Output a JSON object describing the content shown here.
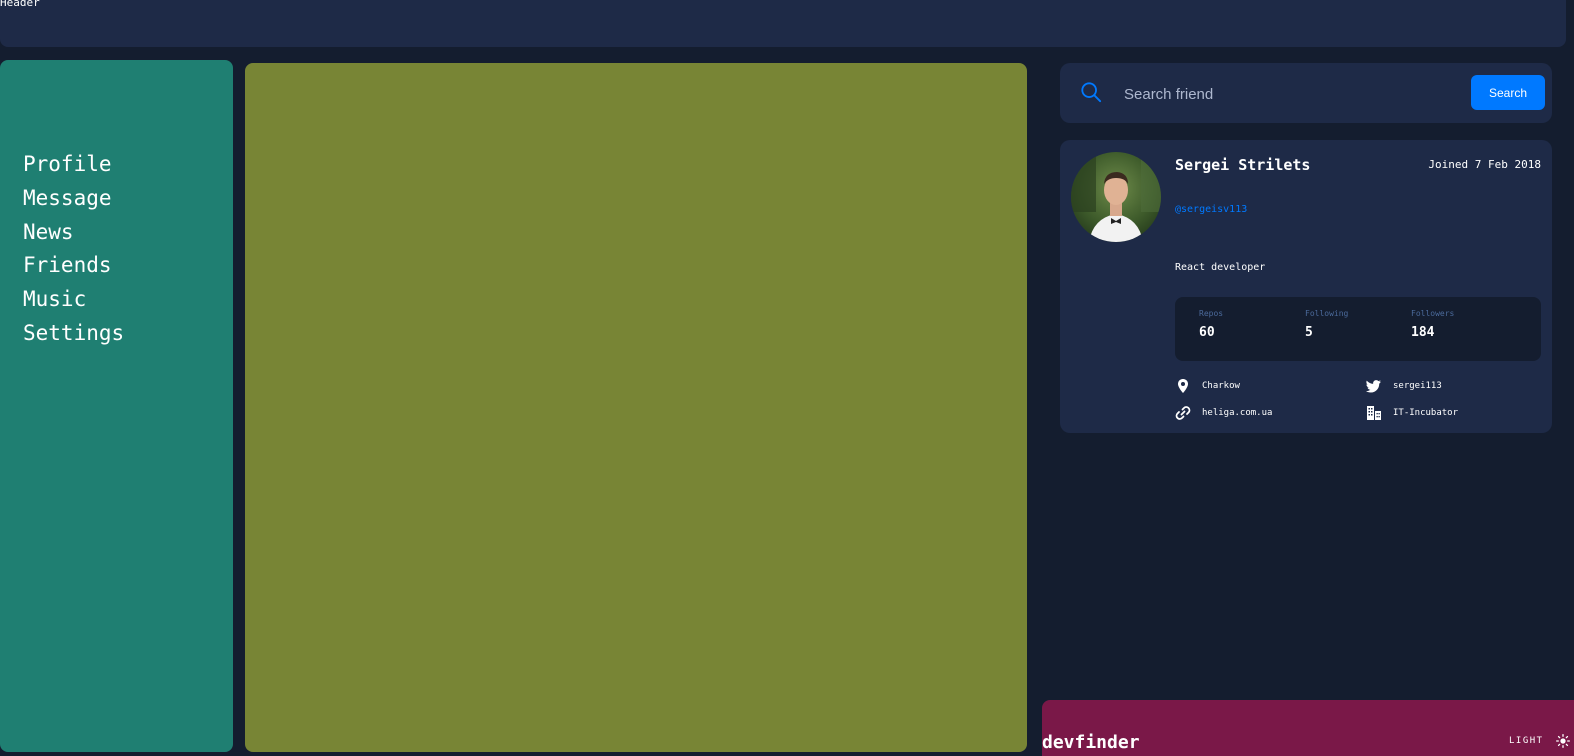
{
  "header": {
    "title": "Header"
  },
  "nav": {
    "items": [
      "Profile",
      "Message",
      "News",
      "Friends",
      "Music",
      "Settings"
    ]
  },
  "search": {
    "placeholder": "Search friend",
    "value": "",
    "button_label": "Search"
  },
  "profile": {
    "name": "Sergei Strilets",
    "joined": "Joined 7 Feb 2018",
    "login": "@sergeisv113",
    "bio": "React developer",
    "stats": {
      "repos_label": "Repos",
      "repos": "60",
      "following_label": "Following",
      "following": "5",
      "followers_label": "Followers",
      "followers": "184"
    },
    "location": "Charkow",
    "twitter": "sergei113",
    "blog": "heliga.com.ua",
    "company": "IT-Incubator"
  },
  "footer": {
    "logo": "devfinder",
    "theme_label": "LIGHT"
  },
  "colors": {
    "background": "#141d2f",
    "panel": "#1e2a47",
    "sidebar": "#1f7f72",
    "content": "#788535",
    "accent": "#0079ff",
    "footer": "#7a1848"
  },
  "icons": {
    "search": "search-icon",
    "location": "location-pin-icon",
    "twitter": "twitter-icon",
    "link": "link-icon",
    "company": "building-icon",
    "theme": "sun-icon"
  }
}
